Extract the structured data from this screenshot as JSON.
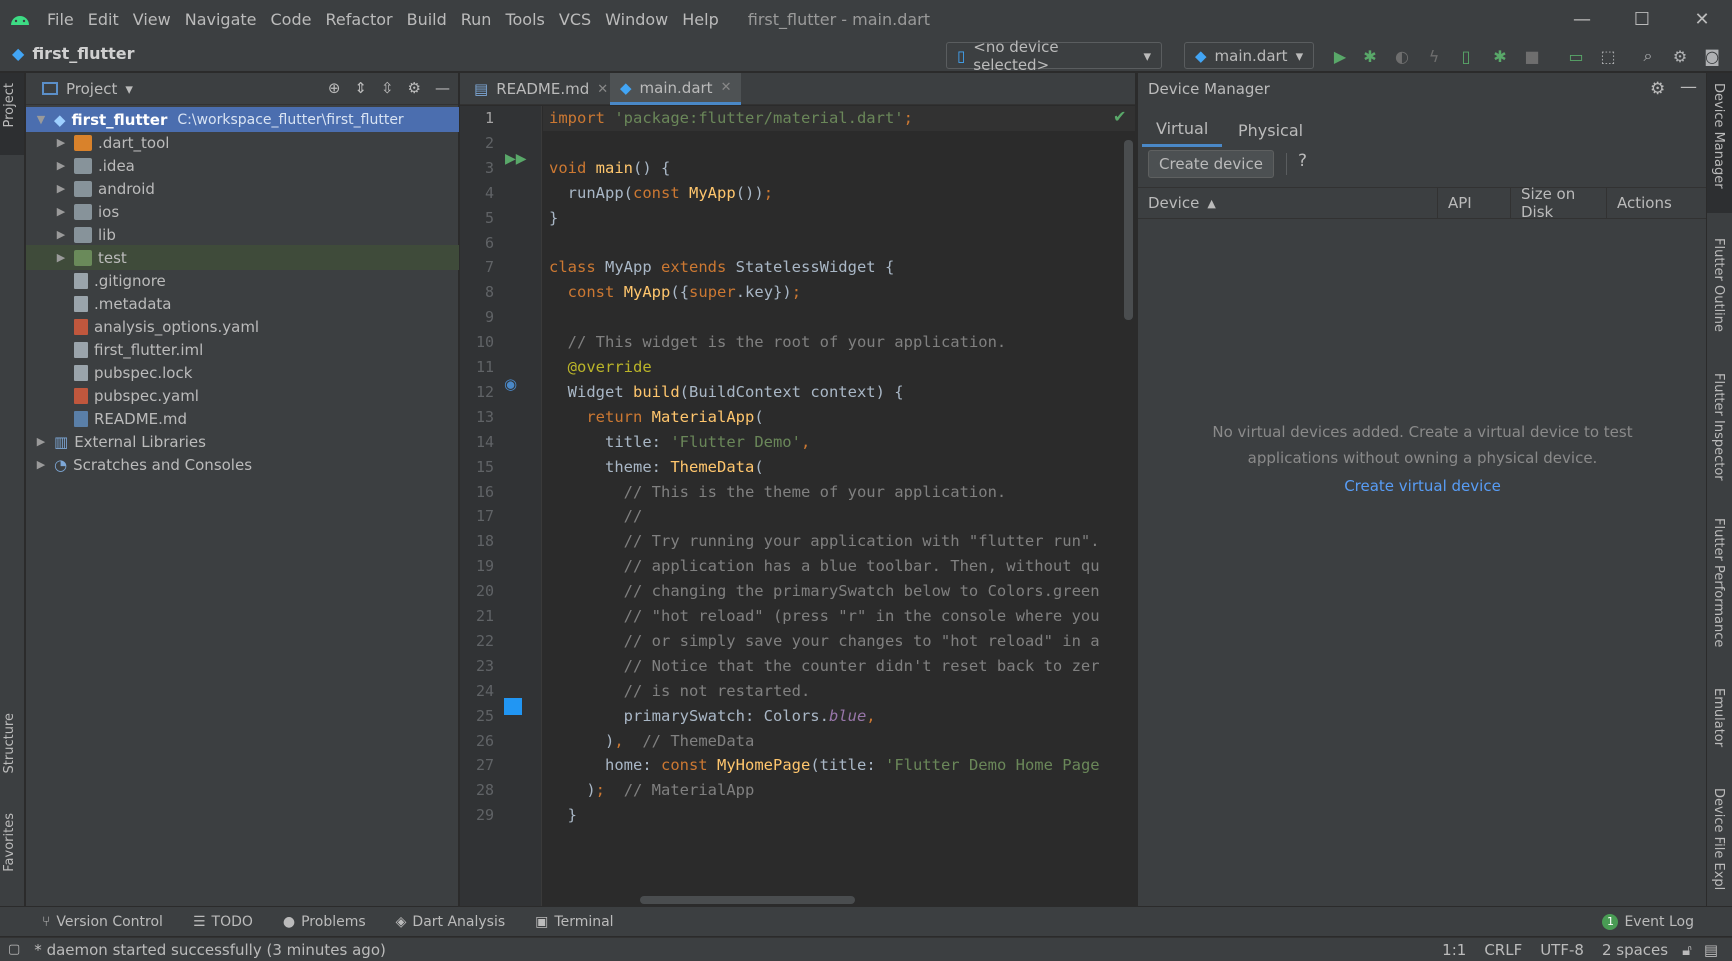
{
  "menubar": {
    "items": [
      "File",
      "Edit",
      "View",
      "Navigate",
      "Code",
      "Refactor",
      "Build",
      "Run",
      "Tools",
      "VCS",
      "Window",
      "Help"
    ],
    "window_title": "first_flutter - main.dart"
  },
  "navbar": {
    "project_name": "first_flutter",
    "device_selector": "<no device selected>",
    "run_config": "main.dart"
  },
  "project_panel": {
    "title": "Project",
    "tree": [
      {
        "label": "first_flutter",
        "path": "C:\\workspace_flutter\\first_flutter"
      },
      {
        "label": ".dart_tool"
      },
      {
        "label": ".idea"
      },
      {
        "label": "android"
      },
      {
        "label": "ios"
      },
      {
        "label": "lib"
      },
      {
        "label": "test"
      },
      {
        "label": ".gitignore"
      },
      {
        "label": ".metadata"
      },
      {
        "label": "analysis_options.yaml"
      },
      {
        "label": "first_flutter.iml"
      },
      {
        "label": "pubspec.lock"
      },
      {
        "label": "pubspec.yaml"
      },
      {
        "label": "README.md"
      },
      {
        "label": "External Libraries"
      },
      {
        "label": "Scratches and Consoles"
      }
    ]
  },
  "left_strip": {
    "project": "Project",
    "structure": "Structure",
    "favorites": "Favorites"
  },
  "right_strip": {
    "device_manager": "Device Manager",
    "flutter_outline": "Flutter Outline",
    "flutter_inspector": "Flutter Inspector",
    "flutter_performance": "Flutter Performance",
    "emulator": "Emulator",
    "device_file_explorer": "Device File Expl"
  },
  "editor": {
    "tabs": [
      {
        "label": "README.md"
      },
      {
        "label": "main.dart"
      }
    ],
    "line_numbers": [
      "1",
      "2",
      "3",
      "4",
      "5",
      "6",
      "7",
      "8",
      "9",
      "10",
      "11",
      "12",
      "13",
      "14",
      "15",
      "16",
      "17",
      "18",
      "19",
      "20",
      "21",
      "22",
      "23",
      "24",
      "25",
      "26",
      "27",
      "28",
      "29"
    ],
    "lines": {
      "l1": "import 'package:flutter/material.dart';",
      "l3": "void main() {",
      "l4": "  runApp(const MyApp());",
      "l5": "}",
      "l7": "class MyApp extends StatelessWidget {",
      "l8": "  const MyApp({super.key});",
      "l10": "  // This widget is the root of your application.",
      "l11": "  @override",
      "l12": "  Widget build(BuildContext context) {",
      "l13": "    return MaterialApp(",
      "l14": "      title: 'Flutter Demo',",
      "l15": "      theme: ThemeData(",
      "l16": "        // This is the theme of your application.",
      "l17": "        //",
      "l18": "        // Try running your application with \"flutter run\".",
      "l19": "        // application has a blue toolbar. Then, without qu",
      "l20": "        // changing the primarySwatch below to Colors.green",
      "l21": "        // \"hot reload\" (press \"r\" in the console where you",
      "l22": "        // or simply save your changes to \"hot reload\" in a",
      "l23": "        // Notice that the counter didn't reset back to zer",
      "l24": "        // is not restarted.",
      "l25": "        primarySwatch: Colors.blue,",
      "l26": "      ),  // ThemeData",
      "l27": "      home: const MyHomePage(title: 'Flutter Demo Home Page",
      "l28": "    );  // MaterialApp",
      "l29": "  }"
    }
  },
  "device_manager": {
    "title": "Device Manager",
    "tabs": [
      "Virtual",
      "Physical"
    ],
    "create_device": "Create device",
    "help": "?",
    "columns": [
      "Device",
      "API",
      "Size on Disk",
      "Actions"
    ],
    "empty_line1": "No virtual devices added. Create a virtual device to test",
    "empty_line2": "applications without owning a physical device.",
    "create_link": "Create virtual device"
  },
  "bottom_tools": [
    "Version Control",
    "TODO",
    "Problems",
    "Dart Analysis",
    "Terminal"
  ],
  "event_log": {
    "count": "1",
    "label": "Event Log"
  },
  "status": {
    "message": "* daemon started successfully (3 minutes ago)",
    "position": "1:1",
    "line_sep": "CRLF",
    "encoding": "UTF-8",
    "indent": "2 spaces"
  },
  "colors": {
    "accent": "#4a88c7",
    "selection": "#4b6eaf",
    "bg": "#2b2b2b",
    "panel": "#3c3f41"
  }
}
